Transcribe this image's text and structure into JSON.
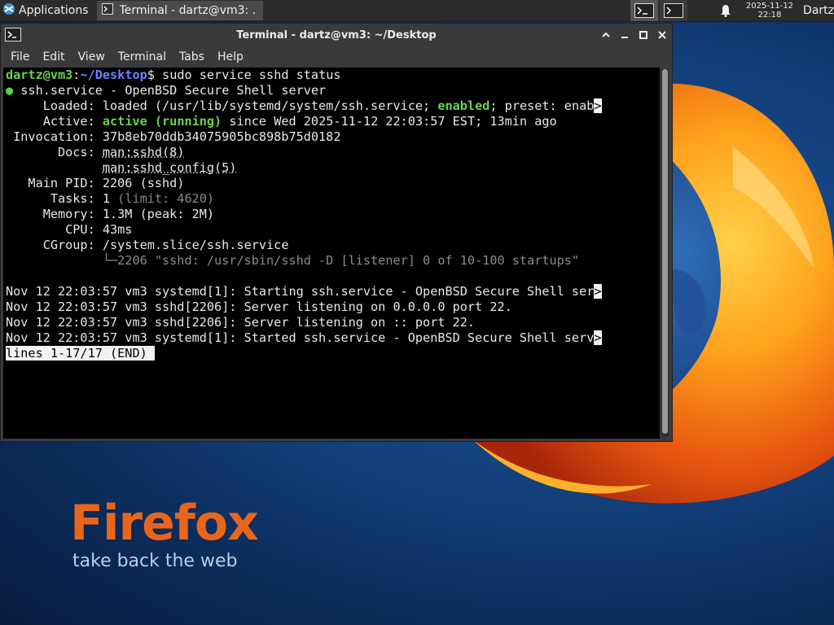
{
  "panel": {
    "apps_label": "Applications",
    "task_label": "Terminal - dartz@vm3: ...",
    "clock_date": "2025-11-12",
    "clock_time": "22:18",
    "user": "Dartz"
  },
  "window": {
    "title": "Terminal - dartz@vm3: ~/Desktop",
    "menu": [
      "File",
      "Edit",
      "View",
      "Terminal",
      "Tabs",
      "Help"
    ]
  },
  "terminal": {
    "prompt_user": "dartz@vm3",
    "prompt_path": "~/Desktop",
    "command": "sudo service sshd status",
    "unit_line": "ssh.service - OpenBSD Secure Shell server",
    "loaded_label": "     Loaded:",
    "loaded_pre": " loaded (/usr/lib/systemd/system/ssh.service;",
    "loaded_enabled": "enabled",
    "loaded_post": "; preset: enab",
    "active_label": "     Active:",
    "active_state": "active (running)",
    "active_post": " since Wed 2025-11-12 22:03:57 EST; 13min ago",
    "invocation": " Invocation: 37b8eb70ddb34075905bc898b75d0182",
    "docs_label": "       Docs:",
    "docs_1": "man:sshd(8)",
    "docs_2": "man:sshd_config(5)",
    "main_pid": "   Main PID: 2206 (sshd)",
    "tasks_label": "      Tasks: 1",
    "tasks_limit": " (limit: 4620)",
    "memory": "     Memory: 1.3M (peak: 2M)",
    "cpu": "        CPU: 43ms",
    "cgroup": "     CGroup: /system.slice/ssh.service",
    "cgroup_child": "2206 \"sshd: /usr/sbin/sshd -D [listener] 0 of 10-100 startups\"",
    "log": [
      "Nov 12 22:03:57 vm3 systemd[1]: Starting ssh.service - OpenBSD Secure Shell ser",
      "Nov 12 22:03:57 vm3 sshd[2206]: Server listening on 0.0.0.0 port 22.",
      "Nov 12 22:03:57 vm3 sshd[2206]: Server listening on :: port 22.",
      "Nov 12 22:03:57 vm3 systemd[1]: Started ssh.service - OpenBSD Secure Shell serv"
    ],
    "pager_status": "lines 1-17/17 (END) "
  },
  "wallpaper": {
    "brand": "Firefox",
    "tagline": "take back the web"
  },
  "colors": {
    "terminal_bg": "#000000",
    "prompt_green": "#6ad34a",
    "prompt_blue": "#6b84ff",
    "firefox_orange": "#e9651c"
  }
}
